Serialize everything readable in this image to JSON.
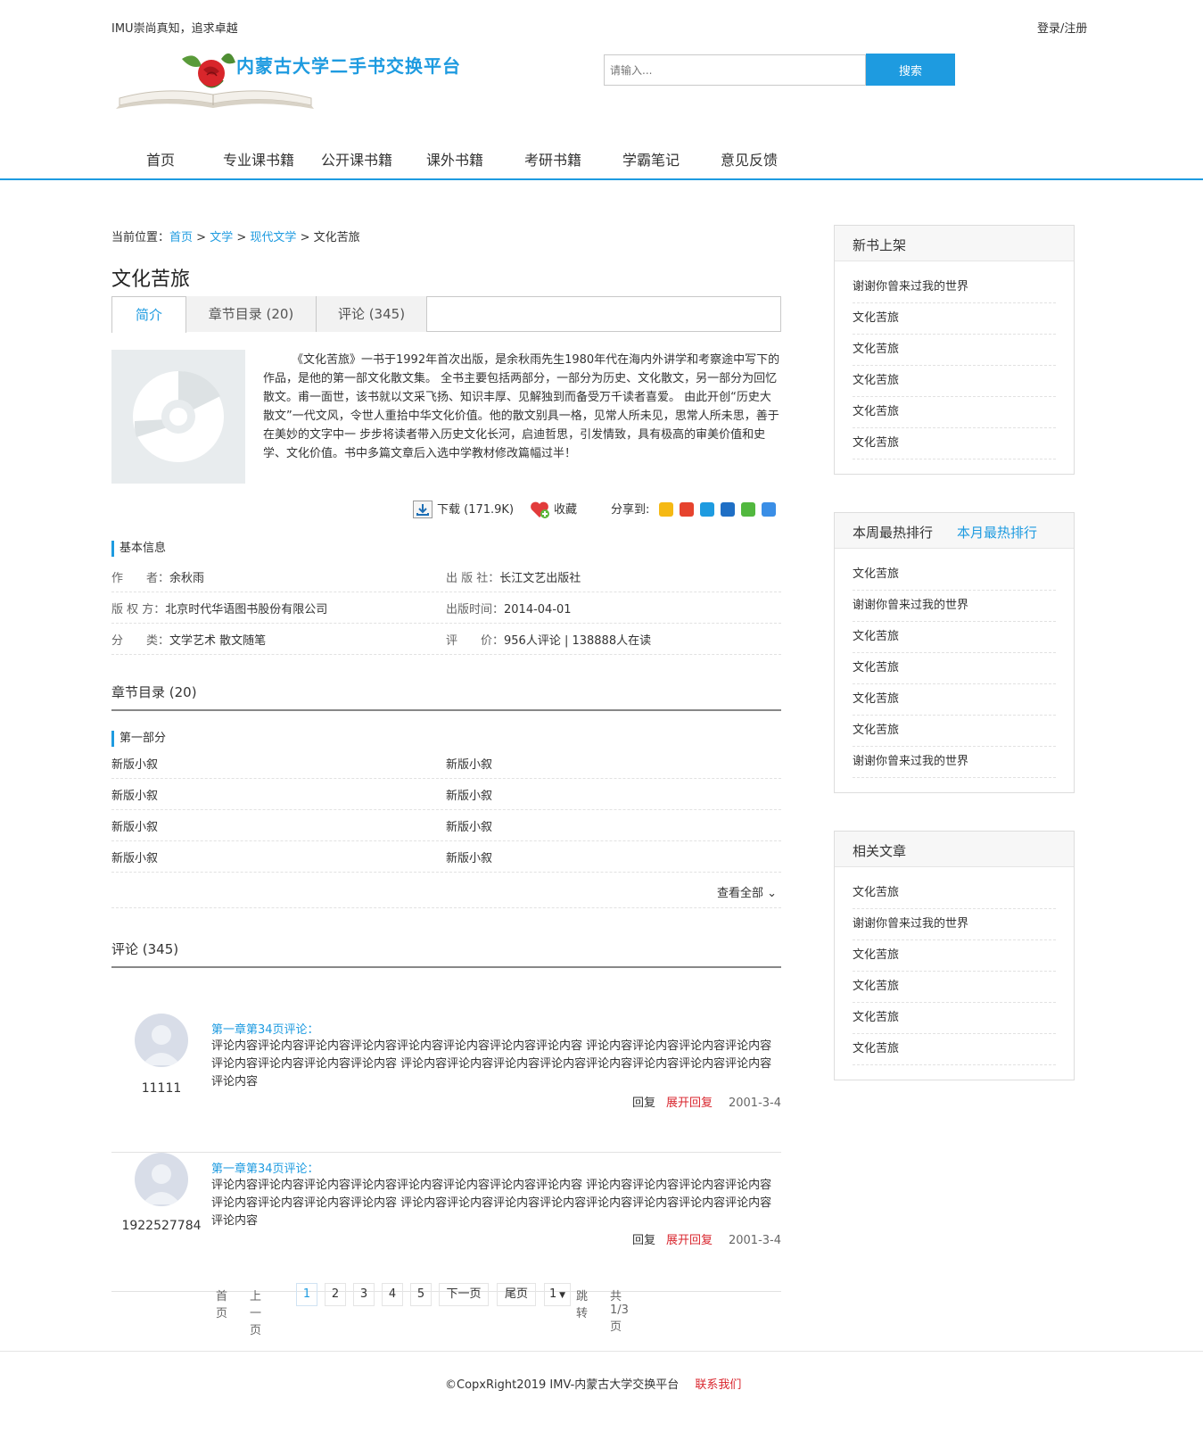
{
  "header": {
    "slogan": "IMU崇尚真知，追求卓越",
    "login": "登录/注册",
    "site_title": "内蒙古大学二手书交换平台",
    "search_placeholder": "请输入...",
    "search_button": "搜索"
  },
  "nav": [
    "首页",
    "专业课书籍",
    "公开课书籍",
    "课外书籍",
    "考研书籍",
    "学霸笔记",
    "意见反馈"
  ],
  "breadcrumb": {
    "prefix": "当前位置：",
    "items": [
      "首页",
      "文学",
      "现代文学"
    ],
    "sep": ">",
    "current": "文化苦旅"
  },
  "book": {
    "title": "文化苦旅",
    "tabs": [
      "简介",
      "章节目录 (20)",
      "评论 (345)"
    ],
    "intro": "《文化苦旅》一书于1992年首次出版，是余秋雨先生1980年代在海内外讲学和考察途中写下的作品，是他的第一部文化散文集。 全书主要包括两部分，一部分为历史、文化散文，另一部分为回忆散文。甫一面世，该书就以文采飞扬、知识丰厚、见解独到而备受万千读者喜爱。 由此开创“历史大散文”一代文风，令世人重拾中华文化价值。他的散文别具一格，见常人所未见，思常人所未思，善于在美妙的文字中一 步步将读者带入历史文化长河，启迪哲思，引发情致，具有极高的审美价值和史学、文化价值。书中多篇文章后入选中学教材修改篇幅过半！",
    "download": "下载 (171.9K)",
    "favorite": "收藏",
    "share_label": "分享到:",
    "share_icons": [
      {
        "name": "qzone-icon",
        "color": "#f5b914"
      },
      {
        "name": "weibo-icon",
        "color": "#e6432e"
      },
      {
        "name": "tencent-icon",
        "color": "#1e9be0"
      },
      {
        "name": "renren-icon",
        "color": "#1f6fc5"
      },
      {
        "name": "wechat-icon",
        "color": "#52b83f"
      },
      {
        "name": "more-icon",
        "color": "#3a8ee6"
      }
    ]
  },
  "basic_info": {
    "heading": "基本信息",
    "rows": [
      [
        {
          "label": "作　　者：",
          "value": "余秋雨"
        },
        {
          "label": "出 版 社：",
          "value": "长江文艺出版社"
        }
      ],
      [
        {
          "label": "版 权 方：",
          "value": "北京时代华语图书股份有限公司"
        },
        {
          "label": "出版时间：",
          "value": "2014-04-01"
        }
      ],
      [
        {
          "label": "分　　类：",
          "value": "文学艺术 散文随笔"
        },
        {
          "label": "评　　价：",
          "value": "956人评论 | 138888人在读"
        }
      ]
    ]
  },
  "chapters": {
    "title": "章节目录 (20)",
    "part": "第一部分",
    "rows": [
      [
        "新版小叙",
        "新版小叙"
      ],
      [
        "新版小叙",
        "新版小叙"
      ],
      [
        "新版小叙",
        "新版小叙"
      ],
      [
        "新版小叙",
        "新版小叙"
      ]
    ],
    "view_all": "查看全部"
  },
  "comments": {
    "title": "评论 (345)",
    "items": [
      {
        "user": "11111",
        "title": "第一章第34页评论：",
        "body": "评论内容评论内容评论内容评论内容评论内容评论内容评论内容评论内容 评论内容评论内容评论内容评论内容评论内容评论内容评论内容评论内容 评论内容评论内容评论内容评论内容评论内容评论内容评论内容评论内容评论内容",
        "reply": "回复",
        "expand": "展开回复",
        "date": "2001-3-4"
      },
      {
        "user": "1922527784",
        "title": "第一章第34页评论：",
        "body": "评论内容评论内容评论内容评论内容评论内容评论内容评论内容评论内容 评论内容评论内容评论内容评论内容评论内容评论内容评论内容评论内容 评论内容评论内容评论内容评论内容评论内容评论内容评论内容评论内容评论内容",
        "reply": "回复",
        "expand": "展开回复",
        "date": "2001-3-4"
      }
    ]
  },
  "pager": {
    "first": "首页",
    "prev": "上一页",
    "pages": [
      "1",
      "2",
      "3",
      "4",
      "5"
    ],
    "next": "下一页",
    "last": "尾页",
    "select_value": "1",
    "jump": "跳转",
    "total": "共 1/3 页"
  },
  "sidebar": {
    "new_books": {
      "title": "新书上架",
      "items": [
        "谢谢你曾来过我的世界",
        "文化苦旅",
        "文化苦旅",
        "文化苦旅",
        "文化苦旅",
        "文化苦旅"
      ]
    },
    "ranking": {
      "title_week": "本周最热排行",
      "title_month": "本月最热排行",
      "items": [
        "文化苦旅",
        "谢谢你曾来过我的世界",
        "文化苦旅",
        "文化苦旅",
        "文化苦旅",
        "文化苦旅",
        "谢谢你曾来过我的世界"
      ]
    },
    "related": {
      "title": "相关文章",
      "items": [
        "文化苦旅",
        "谢谢你曾来过我的世界",
        "文化苦旅",
        "文化苦旅",
        "文化苦旅",
        "文化苦旅"
      ]
    }
  },
  "footer": {
    "copyright": "©CopxRight2019 IMV-内蒙古大学交换平台",
    "contact": "联系我们"
  },
  "colors": {
    "accent": "#1e9be0",
    "red": "#d9262e"
  }
}
